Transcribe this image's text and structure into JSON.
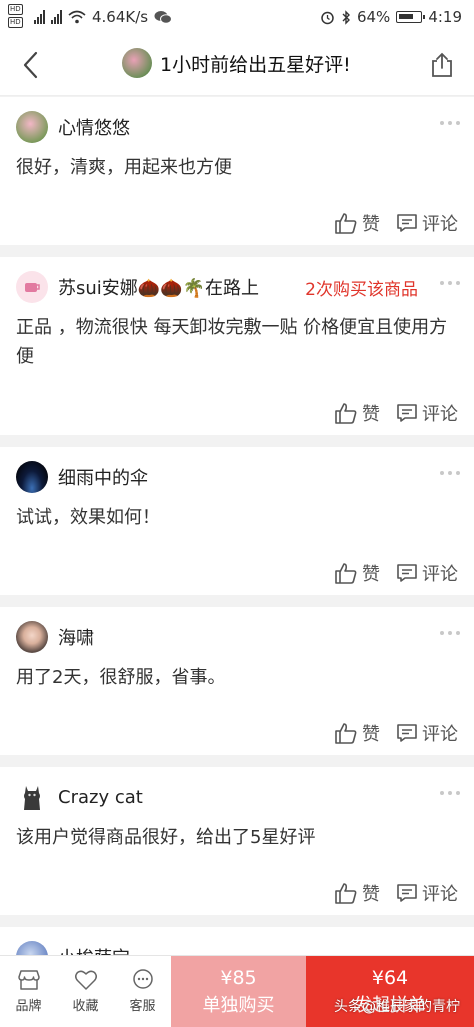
{
  "status_bar": {
    "network_speed": "4.64K/s",
    "battery": "64%",
    "time": "4:19"
  },
  "header": {
    "title": "1小时前给出五星好评!"
  },
  "reviews": [
    {
      "user": "心情悠悠",
      "badge": "",
      "text": "很好，清爽，用起来也方便",
      "like": "赞",
      "comment": "评论"
    },
    {
      "user": "苏sui安娜🌰🌰🌴在路上",
      "badge": "2次购买该商品",
      "text": "正品 ，物流很快 每天卸妆完敷一贴 价格便宜且使用方便",
      "like": "赞",
      "comment": "评论"
    },
    {
      "user": "细雨中的伞",
      "badge": "",
      "text": "试试，效果如何！",
      "like": "赞",
      "comment": "评论"
    },
    {
      "user": "海啸",
      "badge": "",
      "text": "用了2天，很舒服，省事。",
      "like": "赞",
      "comment": "评论"
    },
    {
      "user": "Crazy cat",
      "badge": "",
      "text": "该用户觉得商品很好，给出了5星好评",
      "like": "赞",
      "comment": "评论"
    },
    {
      "user": "小埃萨宝",
      "badge": "",
      "text": "",
      "like": "",
      "comment": ""
    }
  ],
  "bottom_bar": {
    "tabs": [
      {
        "label": "品牌",
        "icon": "store-icon"
      },
      {
        "label": "收藏",
        "icon": "heart-icon"
      },
      {
        "label": "客服",
        "icon": "chat-icon"
      }
    ],
    "single_price": "¥85",
    "single_label": "单独购买",
    "group_price": "¥64",
    "group_label": "发起拼单"
  },
  "watermark": "头条@稚辰家的青柠",
  "colors": {
    "accent_red": "#e8352b",
    "light_red": "#f1a3a3"
  }
}
